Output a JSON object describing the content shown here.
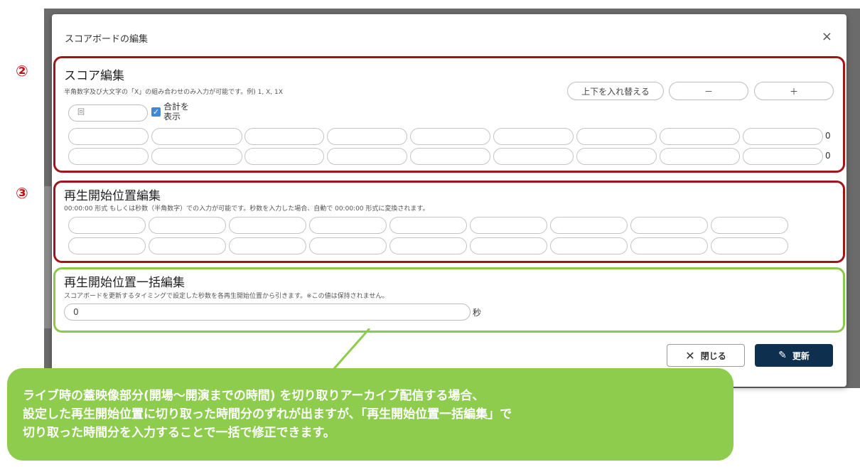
{
  "modal": {
    "title": "スコアボードの編集",
    "close_glyph": "×"
  },
  "markers": {
    "score": "②",
    "playback": "③"
  },
  "score_edit": {
    "title": "スコア編集",
    "note": "半角数字及び大文字の「X」の組み合わせのみ入力が可能です。例) 1, X, 1X",
    "swap_button": "上下を入れ替える",
    "minus_button": "－",
    "plus_button": "＋",
    "inning_placeholder": "回",
    "show_total_label_1": "合計を",
    "show_total_label_2": "表示",
    "show_total_checked": true,
    "row_totals": [
      "0",
      "0"
    ]
  },
  "playback_edit": {
    "title": "再生開始位置編集",
    "note": "00:00:00 形式 もしくは秒数（半角数字）での入力が可能です。秒数を入力した場合、自動で 00:00:00 形式に変換されます。"
  },
  "bulk_edit": {
    "title": "再生開始位置一括編集",
    "note": "スコアボードを更新するタイミングで設定した秒数を各再生開始位置から引きます。※この値は保持されません。",
    "value": "0",
    "unit": "秒"
  },
  "footer": {
    "close_button": "閉じる",
    "update_button": "更新"
  },
  "callout": {
    "line1": "ライブ時の蓋映像部分(開場～開演までの時間) を切り取りアーカイブ配信する場合、",
    "line2": "設定した再生開始位置に切り取った時間分のずれが出ますが、「再生開始位置一括編集」で",
    "line3": "切り取った時間分を入力することで一括で修正できます。"
  },
  "colors": {
    "highlight_red": "#a0151a",
    "highlight_green": "#8cc84b",
    "primary": "#0f2f4e",
    "callout": "#8dcc4c"
  }
}
